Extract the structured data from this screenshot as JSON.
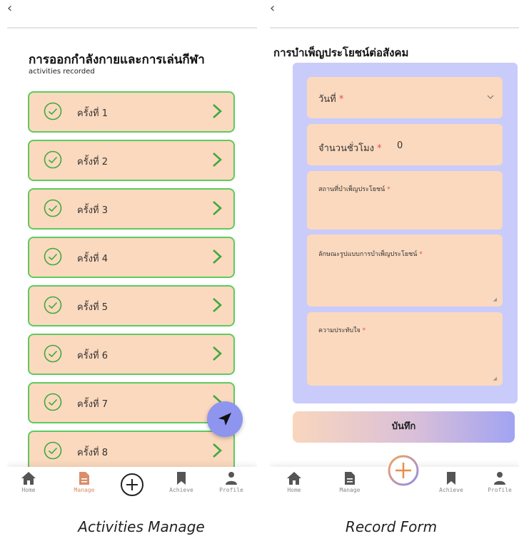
{
  "left_screen": {
    "back_glyph": "‹",
    "title": "การออกกำลังกายและการเล่นกีฬา",
    "subtitle": "activities recorded",
    "items": [
      {
        "label": "ครั้งที่ 1"
      },
      {
        "label": "ครั้งที่ 2"
      },
      {
        "label": "ครั้งที่ 3"
      },
      {
        "label": "ครั้งที่ 4"
      },
      {
        "label": "ครั้งที่ 5"
      },
      {
        "label": "ครั้งที่ 6"
      },
      {
        "label": "ครั้งที่ 7"
      },
      {
        "label": "ครั้งที่ 8"
      }
    ],
    "fab_icon": "send-icon",
    "nav": {
      "home": "Home",
      "manage": "Manage",
      "achieve": "Achieve",
      "profile": "Profile"
    },
    "caption": "Activities Manage"
  },
  "right_screen": {
    "back_glyph": "‹",
    "title": "การบำเพ็ญประโยชน์ต่อสังคม",
    "fields": {
      "date": {
        "label": "วันที่ ",
        "required": "*"
      },
      "hours": {
        "label": "จำนวนชั่วโมง ",
        "required": "*",
        "value": "0"
      },
      "place": {
        "label": "สถานที่บำเพ็ญประโยชน์ ",
        "required": "*"
      },
      "nature": {
        "label": "ลักษณะรูปแบบการบำเพ็ญประโยชน์ ",
        "required": "*"
      },
      "impression": {
        "label": "ความประทับใจ ",
        "required": "*"
      }
    },
    "save_label": "บันทึก",
    "nav": {
      "home": "Home",
      "manage": "Manage",
      "achieve": "Achieve",
      "profile": "Profile"
    },
    "caption": "Record Form"
  },
  "colors": {
    "item_bg": "#fbd9be",
    "item_border": "#5dcb5d",
    "accent_green": "#3fa93f",
    "fab": "#8e95ef",
    "panel": "#c9cbfb",
    "manage_active": "#d98d6a",
    "add_active": "#f0a050"
  }
}
